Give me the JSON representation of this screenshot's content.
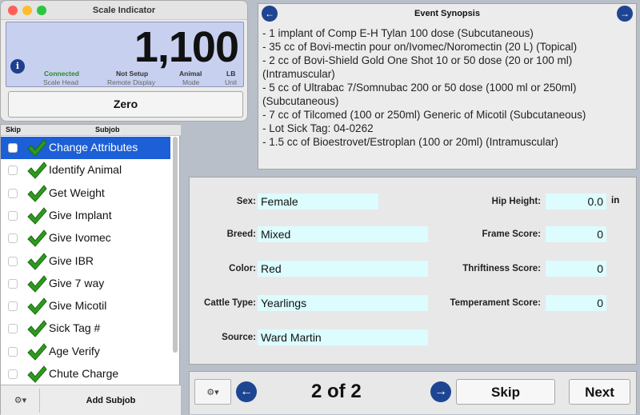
{
  "scale": {
    "title": "Scale Indicator",
    "value": "1,100",
    "statuses": [
      {
        "text": "Connected",
        "label": "Scale Head",
        "color": "#2a8a2a"
      },
      {
        "text": "Not Setup",
        "label": "Remote Display",
        "color": "#333333"
      },
      {
        "text": "Animal",
        "label": "Mode",
        "color": "#333333"
      },
      {
        "text": "LB",
        "label": "Unit",
        "color": "#333333"
      }
    ],
    "zero_label": "Zero"
  },
  "subjobs": {
    "header_skip": "Skip",
    "header_subjob": "Subjob",
    "items": [
      {
        "label": "Change Attributes",
        "selected": true
      },
      {
        "label": "Identify Animal"
      },
      {
        "label": "Get Weight"
      },
      {
        "label": "Give Implant"
      },
      {
        "label": "Give Ivomec"
      },
      {
        "label": "Give IBR"
      },
      {
        "label": "Give 7 way"
      },
      {
        "label": "Give Micotil"
      },
      {
        "label": "Sick Tag #"
      },
      {
        "label": "Age Verify"
      },
      {
        "label": "Chute Charge"
      }
    ],
    "add_label": "Add Subjob",
    "gear_icon": "gear-icon"
  },
  "synopsis": {
    "title": "Event Synopsis",
    "lines": [
      "- 1 implant of Comp E-H Tylan 100 dose (Subcutaneous)",
      "- 35 cc of Bovi-mectin pour on/Ivomec/Noromectin (20 L) (Topical)",
      "- 2 cc of Bovi-Shield Gold One Shot 10 or 50 dose (20 or 100 ml)",
      "(Intramuscular)",
      "- 5 cc of Ultrabac 7/Somnubac 200 or 50 dose (1000 ml or 250ml)",
      "(Subcutaneous)",
      "- 7 cc of Tilcomed (100 or 250ml) Generic of Micotil (Subcutaneous)",
      "- Lot Sick Tag: 04-0262",
      "- 1.5 cc of Bioestrovet/Estroplan (100 or 20ml) (Intramuscular)"
    ]
  },
  "details": {
    "sex_label": "Sex:",
    "sex": "Female",
    "breed_label": "Breed:",
    "breed": "Mixed",
    "color_label": "Color:",
    "color": "Red",
    "type_label": "Cattle Type:",
    "type": "Yearlings",
    "source_label": "Source:",
    "source": "Ward Martin",
    "hip_label": "Hip Height:",
    "hip": "0.0",
    "hip_unit": "in",
    "frame_label": "Frame Score:",
    "frame": "0",
    "thrift_label": "Thriftiness Score:",
    "thrift": "0",
    "temper_label": "Temperament Score:",
    "temper": "0"
  },
  "nav": {
    "record": "2 of 2",
    "skip_label": "Skip",
    "next_label": "Next"
  },
  "colors": {
    "accent": "#1c5fd6",
    "nav_blue": "#1e4591",
    "field_bg": "#dcfcfe",
    "check_green": "#2e9a1f"
  }
}
